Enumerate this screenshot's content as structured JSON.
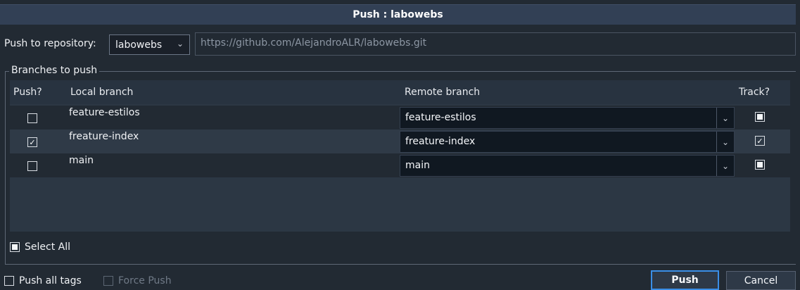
{
  "window": {
    "title": "Push : labowebs"
  },
  "repository": {
    "label": "Push to repository:",
    "selected": "labowebs",
    "url": "https://github.com/AlejandroALR/labowebs.git"
  },
  "branches": {
    "group_label": "Branches to push",
    "columns": {
      "push": "Push?",
      "local": "Local branch",
      "remote": "Remote branch",
      "track": "Track?"
    },
    "rows": [
      {
        "local": "feature-estilos",
        "remote": "feature-estilos",
        "push": "unchecked",
        "track": "partial"
      },
      {
        "local": "freature-index",
        "remote": "freature-index",
        "push": "checked",
        "track": "checked"
      },
      {
        "local": "main",
        "remote": "main",
        "push": "unchecked",
        "track": "partial"
      }
    ]
  },
  "select_all": {
    "label": "Select All",
    "state": "partial"
  },
  "options": {
    "push_all_tags": {
      "label": "Push all tags",
      "state": "unchecked"
    },
    "force_push": {
      "label": "Force Push",
      "state": "unchecked",
      "enabled": false
    }
  },
  "buttons": {
    "push": "Push",
    "cancel": "Cancel"
  },
  "colors": {
    "accent": "#3a8ee6",
    "background": "#222a33",
    "title_bar": "#324055"
  }
}
